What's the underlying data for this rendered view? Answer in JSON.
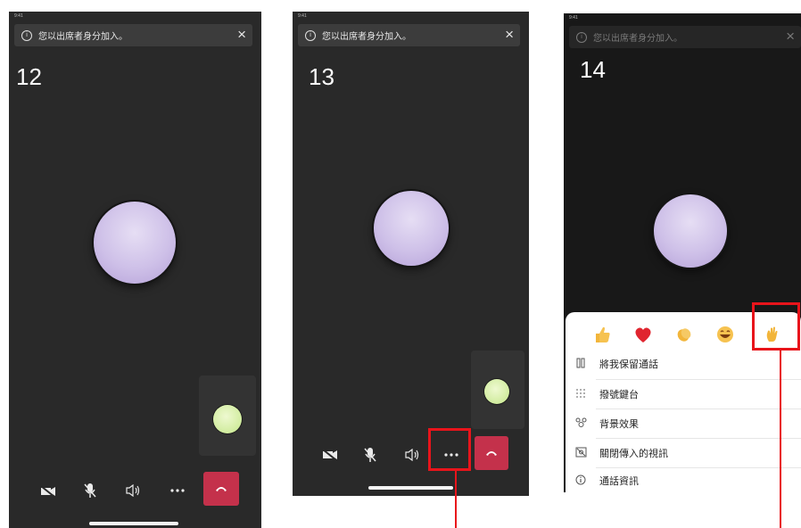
{
  "banner": {
    "text": "您以出席者身分加入。",
    "info_icon": "info-icon",
    "close_icon": "close-icon"
  },
  "statusbar": "9:41",
  "steps": {
    "s12": "12",
    "s13": "13",
    "s14": "14"
  },
  "controls": [
    "camera-off-icon",
    "mic-off-icon",
    "speaker-icon",
    "more-options-icon",
    "hang-up-icon"
  ],
  "reactions": [
    "thumbs-up-icon",
    "heart-icon",
    "clap-icon",
    "laugh-icon",
    "raise-hand-icon"
  ],
  "menu": {
    "items": [
      {
        "icon": "pause-icon",
        "label": "將我保留通話"
      },
      {
        "icon": "dialpad-icon",
        "label": "撥號鍵台"
      },
      {
        "icon": "background-effects-icon",
        "label": "背景效果"
      },
      {
        "icon": "incoming-video-off-icon",
        "label": "關閉傳入的視訊"
      },
      {
        "icon": "info-icon",
        "label": "通話資訊"
      }
    ]
  },
  "colors": {
    "accent_red": "#e8141b",
    "hangup": "#c4314b",
    "avatar": "#d2c6ea",
    "self_dot": "#d5ef9f"
  }
}
